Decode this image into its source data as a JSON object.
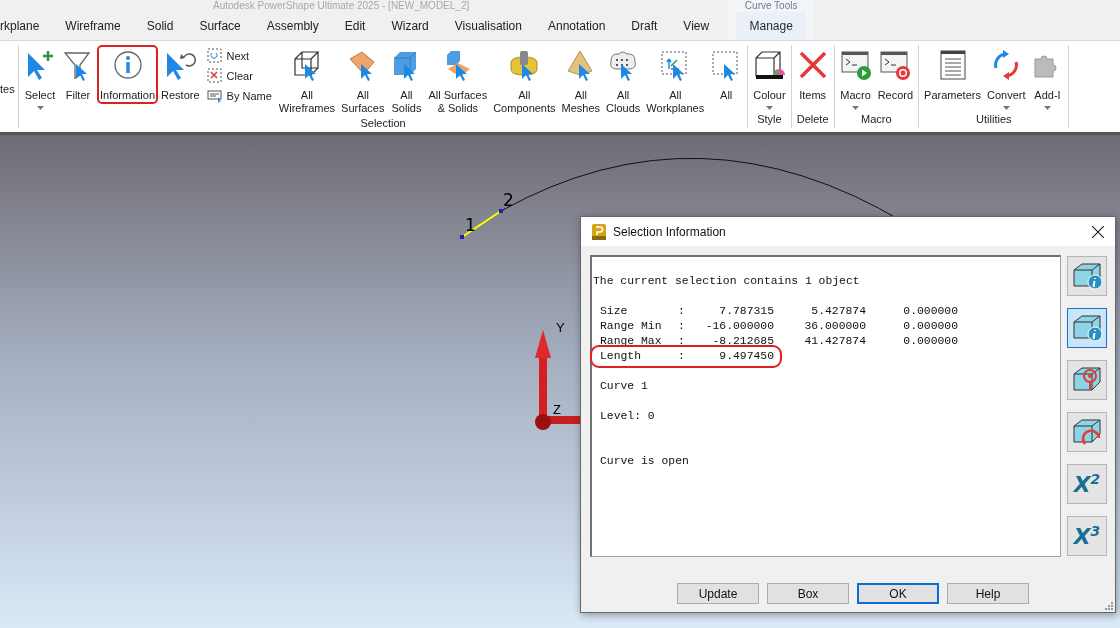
{
  "window": {
    "title": "Autodesk PowerShape Ultimate 2025 - [NEW_MODEL_2]"
  },
  "contextual_tab_group": {
    "label": "Curve Tools"
  },
  "tabs": [
    {
      "label": "rkplane",
      "contextual": false
    },
    {
      "label": "Wireframe",
      "contextual": false
    },
    {
      "label": "Solid",
      "contextual": false
    },
    {
      "label": "Surface",
      "contextual": false
    },
    {
      "label": "Assembly",
      "contextual": false
    },
    {
      "label": "Edit",
      "contextual": false
    },
    {
      "label": "Wizard",
      "contextual": false
    },
    {
      "label": "Visualisation",
      "contextual": false
    },
    {
      "label": "Annotation",
      "contextual": false
    },
    {
      "label": "Draft",
      "contextual": false
    },
    {
      "label": "View",
      "contextual": false
    },
    {
      "label": "Manage",
      "contextual": true
    }
  ],
  "ribbon": {
    "partial_group_label": "tes",
    "groups": [
      {
        "label": "Selection",
        "items": [
          {
            "kind": "large",
            "lines": [
              "Select"
            ],
            "dropdown": true,
            "highlighted": false
          },
          {
            "kind": "large",
            "lines": [
              "Filter"
            ],
            "dropdown": false,
            "highlighted": false
          },
          {
            "kind": "large",
            "lines": [
              "Information"
            ],
            "dropdown": false,
            "highlighted": true
          },
          {
            "kind": "large",
            "lines": [
              "Restore"
            ],
            "dropdown": false,
            "highlighted": false
          },
          {
            "kind": "stack",
            "items": [
              {
                "label": "Next"
              },
              {
                "label": "Clear"
              },
              {
                "label": "By Name"
              }
            ]
          },
          {
            "kind": "large",
            "lines": [
              "All",
              "Wireframes"
            ],
            "dropdown": false,
            "highlighted": false
          },
          {
            "kind": "large",
            "lines": [
              "All",
              "Surfaces"
            ],
            "dropdown": false,
            "highlighted": false
          },
          {
            "kind": "large",
            "lines": [
              "All",
              "Solids"
            ],
            "dropdown": false,
            "highlighted": false
          },
          {
            "kind": "large",
            "lines": [
              "All Surfaces",
              "& Solids"
            ],
            "dropdown": false,
            "highlighted": false
          },
          {
            "kind": "large",
            "lines": [
              "All",
              "Components"
            ],
            "dropdown": false,
            "highlighted": false
          },
          {
            "kind": "large",
            "lines": [
              "All",
              "Meshes"
            ],
            "dropdown": false,
            "highlighted": false
          },
          {
            "kind": "large",
            "lines": [
              "All",
              "Clouds"
            ],
            "dropdown": false,
            "highlighted": false
          },
          {
            "kind": "large",
            "lines": [
              "All",
              "Workplanes"
            ],
            "dropdown": false,
            "highlighted": false
          },
          {
            "kind": "large",
            "lines": [
              "All"
            ],
            "dropdown": false,
            "highlighted": false
          }
        ]
      },
      {
        "label": "Style",
        "items": [
          {
            "kind": "large",
            "lines": [
              "Colour"
            ],
            "dropdown": true,
            "highlighted": false
          }
        ]
      },
      {
        "label": "Delete",
        "items": [
          {
            "kind": "large",
            "lines": [
              "Items"
            ],
            "dropdown": false,
            "highlighted": false
          }
        ]
      },
      {
        "label": "Macro",
        "items": [
          {
            "kind": "large",
            "lines": [
              "Macro"
            ],
            "dropdown": true,
            "highlighted": false
          },
          {
            "kind": "large",
            "lines": [
              "Record"
            ],
            "dropdown": false,
            "highlighted": false
          }
        ]
      },
      {
        "label": "Utilities",
        "items": [
          {
            "kind": "large",
            "lines": [
              "Parameters"
            ],
            "dropdown": false,
            "highlighted": false
          },
          {
            "kind": "large",
            "lines": [
              "Convert"
            ],
            "dropdown": true,
            "highlighted": false
          },
          {
            "kind": "large",
            "lines": [
              "Add-I"
            ],
            "dropdown": true,
            "highlighted": false
          }
        ]
      }
    ]
  },
  "viewport": {
    "point_labels": [
      "1",
      "2"
    ],
    "axis_labels": [
      "Y",
      "Z"
    ]
  },
  "dialog": {
    "title": "Selection Information",
    "summary": "The current selection contains 1 object",
    "rows": [
      {
        "label": "Size",
        "separator": ":",
        "values": [
          "7.787315",
          "5.427874",
          "0.000000"
        ],
        "highlighted": false
      },
      {
        "label": "Range Min",
        "separator": ":",
        "values": [
          "-16.000000",
          "36.000000",
          "0.000000"
        ],
        "highlighted": false
      },
      {
        "label": "Range Max",
        "separator": ":",
        "values": [
          "-8.212685",
          "41.427874",
          "0.000000"
        ],
        "highlighted": false
      },
      {
        "label": "Length",
        "separator": ":",
        "values": [
          "9.497450"
        ],
        "highlighted": true
      }
    ],
    "notes": [
      "Curve 1",
      "Level: 0",
      "Curve is open"
    ],
    "side_buttons": [
      {
        "kind": "icon",
        "selected": false
      },
      {
        "kind": "icon",
        "selected": true
      },
      {
        "kind": "icon",
        "selected": false
      },
      {
        "kind": "icon",
        "selected": false
      },
      {
        "kind": "text",
        "label": "X$^{2}$",
        "selected": false
      },
      {
        "kind": "text",
        "label": "X$^{3}$",
        "selected": false
      }
    ],
    "buttons": [
      {
        "label": "Update",
        "default": false
      },
      {
        "label": "Box",
        "default": false
      },
      {
        "label": "OK",
        "default": true
      },
      {
        "label": "Help",
        "default": false
      }
    ]
  }
}
